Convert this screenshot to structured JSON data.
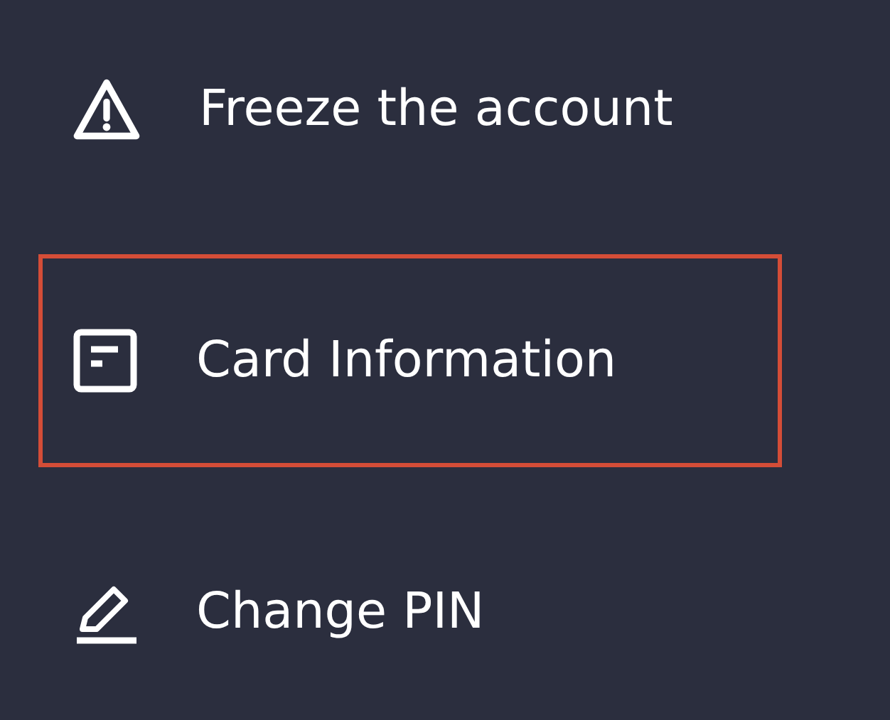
{
  "menu": {
    "items": [
      {
        "label": "Freeze the account",
        "selected": false
      },
      {
        "label": "Card Information",
        "selected": true
      },
      {
        "label": "Change PIN",
        "selected": false
      }
    ]
  }
}
